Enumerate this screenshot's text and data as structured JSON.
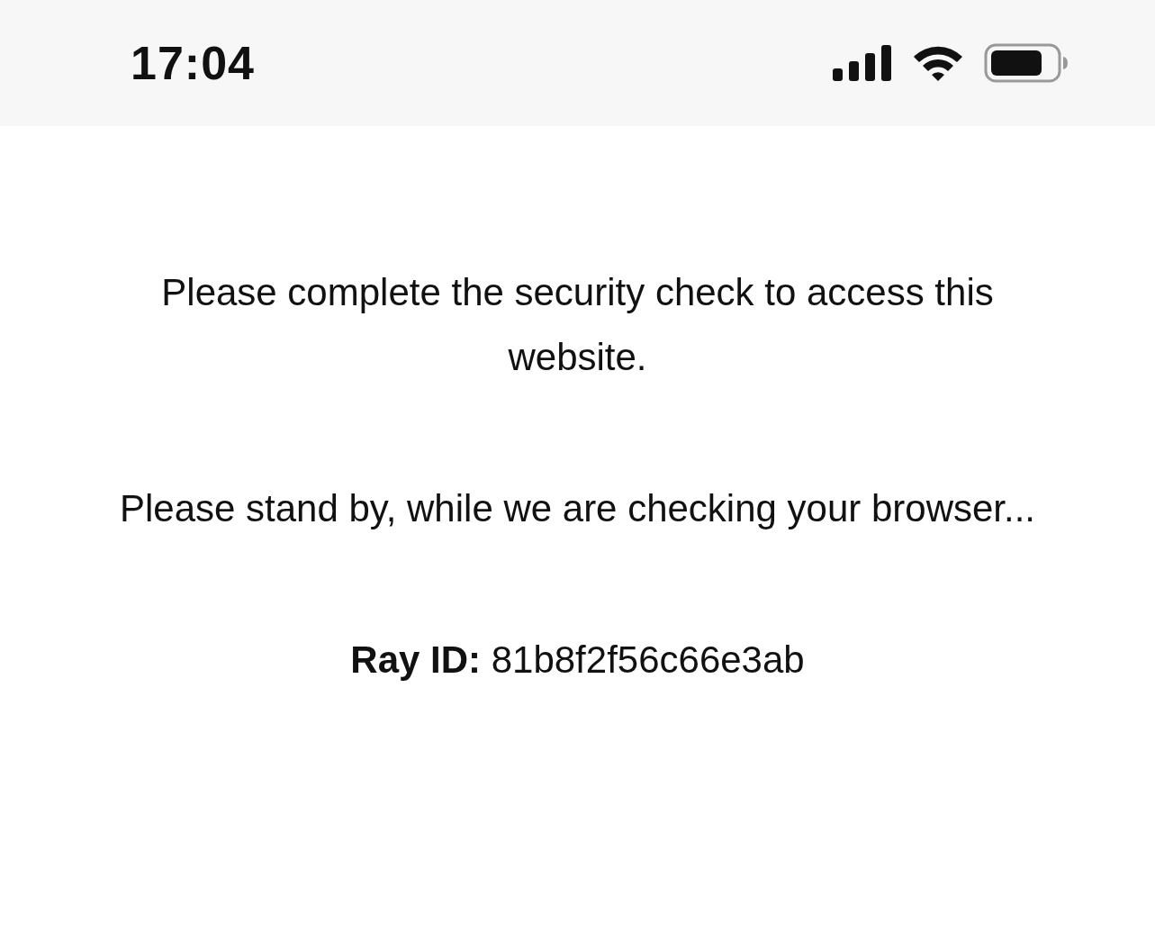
{
  "status_bar": {
    "time": "17:04"
  },
  "paragraphs": [
    "Please complete the security check to access this website.",
    "Please stand by, while we are checking your browser...",
    "**Ray ID:** 81b8f2f56c66e3ab"
  ]
}
